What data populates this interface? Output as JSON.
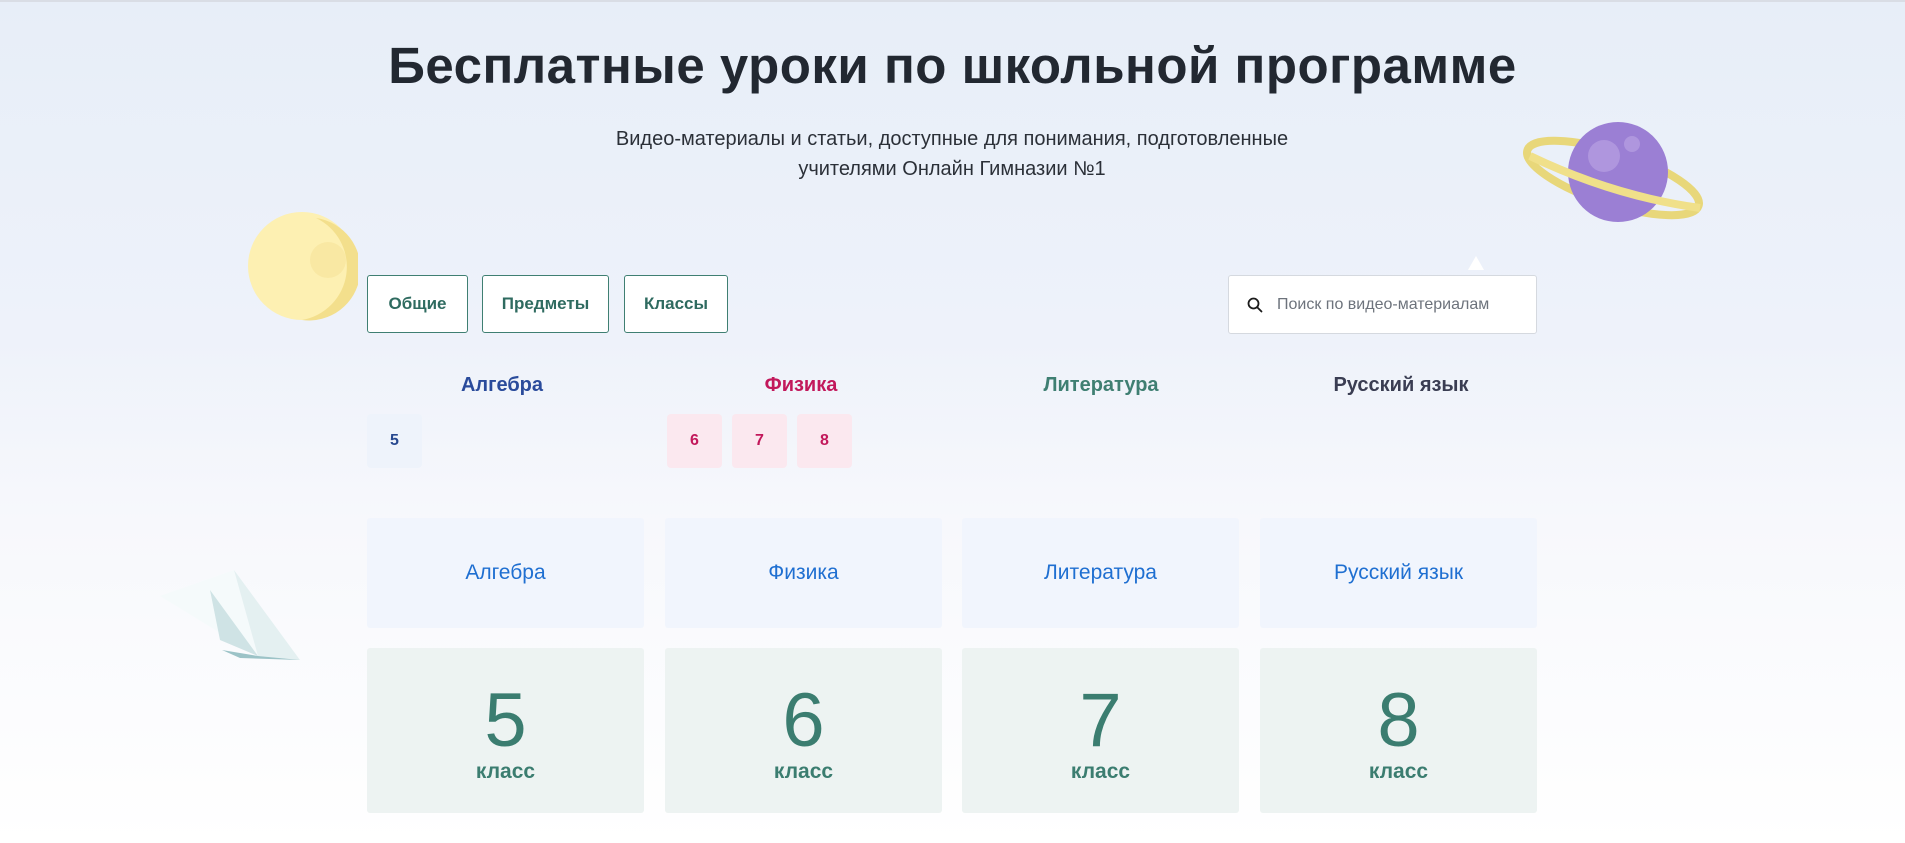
{
  "hero": {
    "title": "Бесплатные уроки по школьной программе",
    "subtitle_line1": "Видео-материалы и статьи, доступные для понимания, подготовленные",
    "subtitle_line2": "учителями Онлайн Гимназии №1"
  },
  "filters": [
    {
      "label": "Общие"
    },
    {
      "label": "Предметы"
    },
    {
      "label": "Классы"
    }
  ],
  "search": {
    "placeholder": "Поиск по видео-материалам",
    "icon": "search-icon"
  },
  "subject_headers": [
    {
      "label": "Алгебра",
      "color": "#2a4b9b",
      "grades": [
        "5"
      ]
    },
    {
      "label": "Физика",
      "color": "#c2185b",
      "grades": [
        "6",
        "7",
        "8"
      ]
    },
    {
      "label": "Литература",
      "color": "#3f7f72",
      "grades": []
    },
    {
      "label": "Русский язык",
      "color": "#3a3d52",
      "grades": []
    }
  ],
  "subject_cards": [
    {
      "label": "Алгебра"
    },
    {
      "label": "Физика"
    },
    {
      "label": "Литература"
    },
    {
      "label": "Русский язык"
    }
  ],
  "grade_cards": [
    {
      "number": "5",
      "word": "класс"
    },
    {
      "number": "6",
      "word": "класс"
    },
    {
      "number": "7",
      "word": "класс"
    },
    {
      "number": "8",
      "word": "класс"
    }
  ],
  "decorations": [
    "moon-illustration",
    "planet-illustration",
    "paper-plane-illustration"
  ],
  "colors": {
    "accent_green": "#3f7f72",
    "link_blue": "#1f6fd1",
    "physics_pink": "#c2185b",
    "algebra_blue": "#2a4b9b",
    "title_dark": "#222831"
  }
}
